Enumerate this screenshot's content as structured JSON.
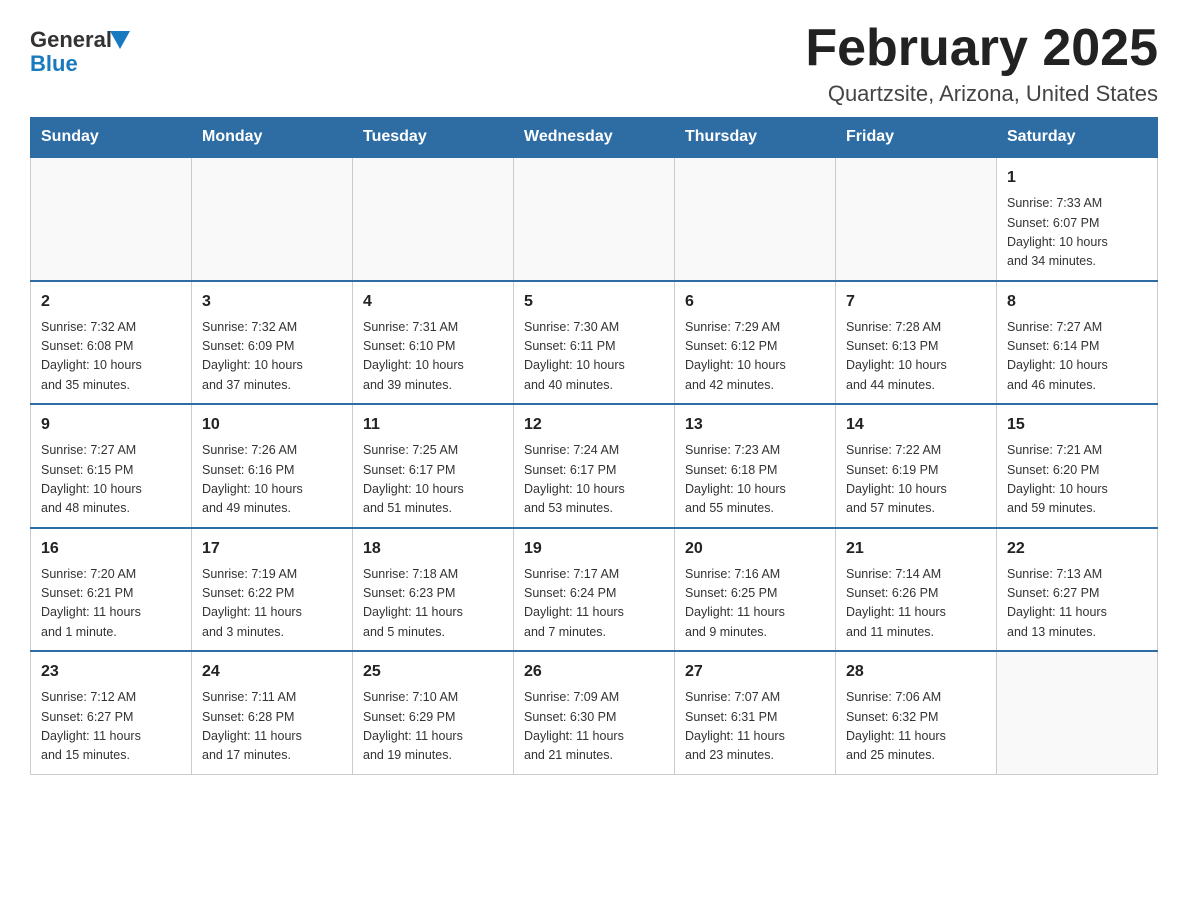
{
  "header": {
    "logo_general": "General",
    "logo_blue": "Blue",
    "title": "February 2025",
    "subtitle": "Quartzsite, Arizona, United States"
  },
  "weekdays": [
    "Sunday",
    "Monday",
    "Tuesday",
    "Wednesday",
    "Thursday",
    "Friday",
    "Saturday"
  ],
  "weeks": [
    [
      {
        "day": "",
        "info": ""
      },
      {
        "day": "",
        "info": ""
      },
      {
        "day": "",
        "info": ""
      },
      {
        "day": "",
        "info": ""
      },
      {
        "day": "",
        "info": ""
      },
      {
        "day": "",
        "info": ""
      },
      {
        "day": "1",
        "info": "Sunrise: 7:33 AM\nSunset: 6:07 PM\nDaylight: 10 hours\nand 34 minutes."
      }
    ],
    [
      {
        "day": "2",
        "info": "Sunrise: 7:32 AM\nSunset: 6:08 PM\nDaylight: 10 hours\nand 35 minutes."
      },
      {
        "day": "3",
        "info": "Sunrise: 7:32 AM\nSunset: 6:09 PM\nDaylight: 10 hours\nand 37 minutes."
      },
      {
        "day": "4",
        "info": "Sunrise: 7:31 AM\nSunset: 6:10 PM\nDaylight: 10 hours\nand 39 minutes."
      },
      {
        "day": "5",
        "info": "Sunrise: 7:30 AM\nSunset: 6:11 PM\nDaylight: 10 hours\nand 40 minutes."
      },
      {
        "day": "6",
        "info": "Sunrise: 7:29 AM\nSunset: 6:12 PM\nDaylight: 10 hours\nand 42 minutes."
      },
      {
        "day": "7",
        "info": "Sunrise: 7:28 AM\nSunset: 6:13 PM\nDaylight: 10 hours\nand 44 minutes."
      },
      {
        "day": "8",
        "info": "Sunrise: 7:27 AM\nSunset: 6:14 PM\nDaylight: 10 hours\nand 46 minutes."
      }
    ],
    [
      {
        "day": "9",
        "info": "Sunrise: 7:27 AM\nSunset: 6:15 PM\nDaylight: 10 hours\nand 48 minutes."
      },
      {
        "day": "10",
        "info": "Sunrise: 7:26 AM\nSunset: 6:16 PM\nDaylight: 10 hours\nand 49 minutes."
      },
      {
        "day": "11",
        "info": "Sunrise: 7:25 AM\nSunset: 6:17 PM\nDaylight: 10 hours\nand 51 minutes."
      },
      {
        "day": "12",
        "info": "Sunrise: 7:24 AM\nSunset: 6:17 PM\nDaylight: 10 hours\nand 53 minutes."
      },
      {
        "day": "13",
        "info": "Sunrise: 7:23 AM\nSunset: 6:18 PM\nDaylight: 10 hours\nand 55 minutes."
      },
      {
        "day": "14",
        "info": "Sunrise: 7:22 AM\nSunset: 6:19 PM\nDaylight: 10 hours\nand 57 minutes."
      },
      {
        "day": "15",
        "info": "Sunrise: 7:21 AM\nSunset: 6:20 PM\nDaylight: 10 hours\nand 59 minutes."
      }
    ],
    [
      {
        "day": "16",
        "info": "Sunrise: 7:20 AM\nSunset: 6:21 PM\nDaylight: 11 hours\nand 1 minute."
      },
      {
        "day": "17",
        "info": "Sunrise: 7:19 AM\nSunset: 6:22 PM\nDaylight: 11 hours\nand 3 minutes."
      },
      {
        "day": "18",
        "info": "Sunrise: 7:18 AM\nSunset: 6:23 PM\nDaylight: 11 hours\nand 5 minutes."
      },
      {
        "day": "19",
        "info": "Sunrise: 7:17 AM\nSunset: 6:24 PM\nDaylight: 11 hours\nand 7 minutes."
      },
      {
        "day": "20",
        "info": "Sunrise: 7:16 AM\nSunset: 6:25 PM\nDaylight: 11 hours\nand 9 minutes."
      },
      {
        "day": "21",
        "info": "Sunrise: 7:14 AM\nSunset: 6:26 PM\nDaylight: 11 hours\nand 11 minutes."
      },
      {
        "day": "22",
        "info": "Sunrise: 7:13 AM\nSunset: 6:27 PM\nDaylight: 11 hours\nand 13 minutes."
      }
    ],
    [
      {
        "day": "23",
        "info": "Sunrise: 7:12 AM\nSunset: 6:27 PM\nDaylight: 11 hours\nand 15 minutes."
      },
      {
        "day": "24",
        "info": "Sunrise: 7:11 AM\nSunset: 6:28 PM\nDaylight: 11 hours\nand 17 minutes."
      },
      {
        "day": "25",
        "info": "Sunrise: 7:10 AM\nSunset: 6:29 PM\nDaylight: 11 hours\nand 19 minutes."
      },
      {
        "day": "26",
        "info": "Sunrise: 7:09 AM\nSunset: 6:30 PM\nDaylight: 11 hours\nand 21 minutes."
      },
      {
        "day": "27",
        "info": "Sunrise: 7:07 AM\nSunset: 6:31 PM\nDaylight: 11 hours\nand 23 minutes."
      },
      {
        "day": "28",
        "info": "Sunrise: 7:06 AM\nSunset: 6:32 PM\nDaylight: 11 hours\nand 25 minutes."
      },
      {
        "day": "",
        "info": ""
      }
    ]
  ]
}
